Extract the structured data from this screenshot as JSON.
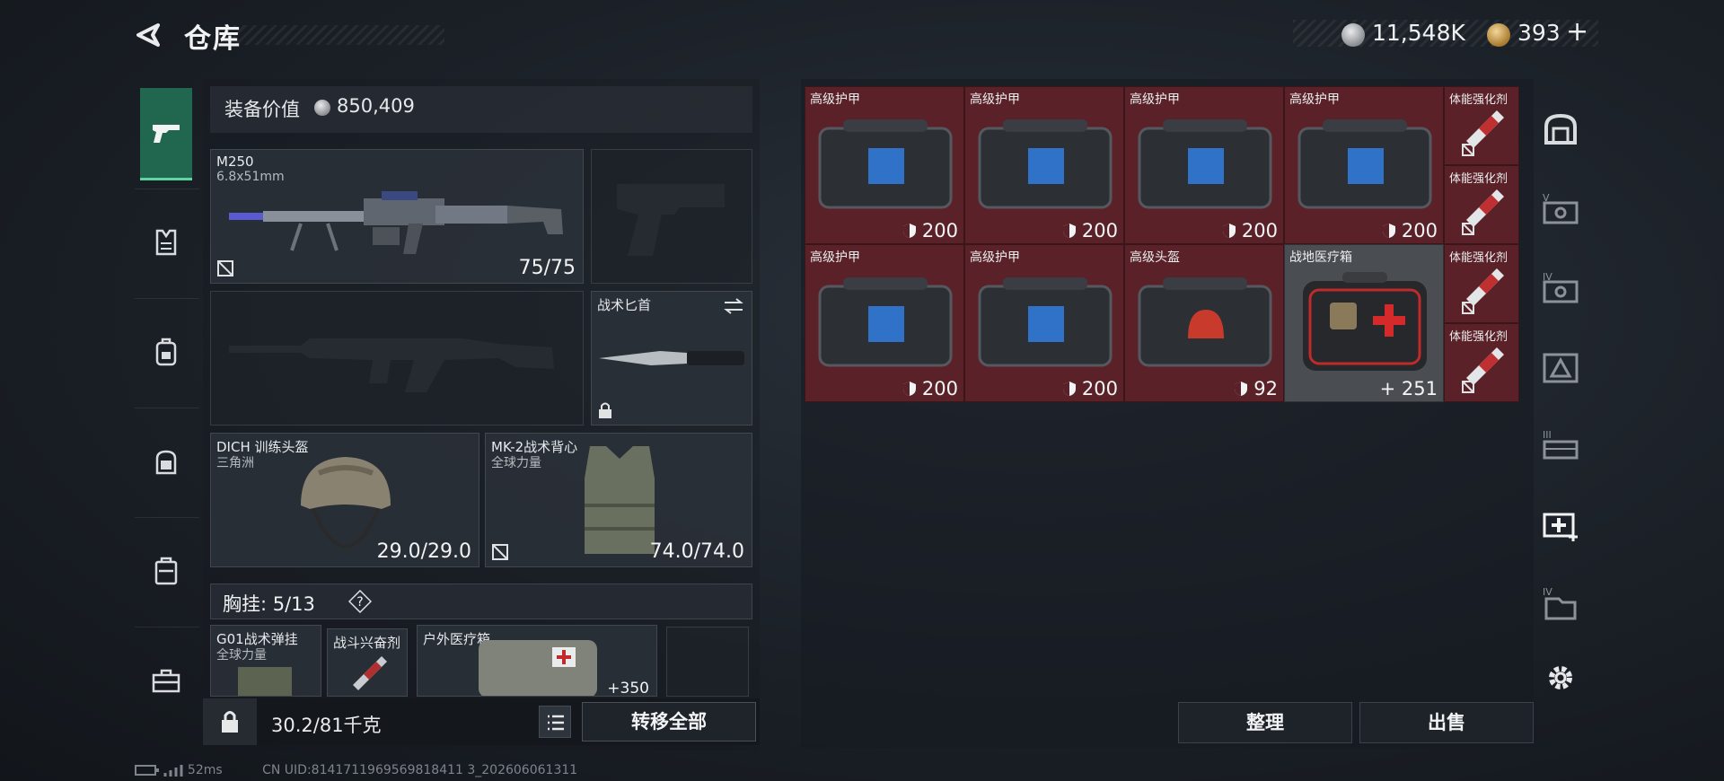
{
  "header": {
    "title": "仓库",
    "currency_silver": "11,548K",
    "currency_gold": "393",
    "gold_add": "+"
  },
  "equipment": {
    "value_label": "装备价值",
    "value_amount": "850,409",
    "primary": {
      "name": "M250",
      "caliber": "6.8x51mm",
      "ammo": "75/75"
    },
    "knife": {
      "name": "战术匕首"
    },
    "helmet": {
      "name": "DICH 训练头盔",
      "faction": "三角洲",
      "durability": "29.0/29.0"
    },
    "vest": {
      "name": "MK-2战术背心",
      "faction": "全球力量",
      "durability": "74.0/74.0"
    },
    "chest_rig": {
      "label": "胸挂: 5/13",
      "help": "?"
    },
    "rig_items": [
      {
        "name": "G01战术弹挂",
        "sub": "全球力量"
      },
      {
        "name": "战斗兴奋剂",
        "sub": ""
      },
      {
        "name": "户外医疗箱",
        "sub": "",
        "value": "+350"
      }
    ]
  },
  "bottom_left": {
    "weight": "30.2/81千克",
    "transfer_all": "转移全部"
  },
  "storage": {
    "items": [
      {
        "name": "高级护甲",
        "value": "200",
        "color": "red"
      },
      {
        "name": "高级护甲",
        "value": "200",
        "color": "red"
      },
      {
        "name": "高级护甲",
        "value": "200",
        "color": "red"
      },
      {
        "name": "高级护甲",
        "value": "200",
        "color": "red"
      },
      {
        "name": "高级护甲",
        "value": "200",
        "color": "red"
      },
      {
        "name": "高级护甲",
        "value": "200",
        "color": "red"
      },
      {
        "name": "高级头盔",
        "value": "92",
        "color": "red"
      },
      {
        "name": "战地医疗箱",
        "value": "+ 251",
        "color": "gray"
      }
    ],
    "small_items": [
      {
        "name": "体能强化剂"
      },
      {
        "name": "体能强化剂"
      },
      {
        "name": "体能强化剂"
      },
      {
        "name": "体能强化剂"
      }
    ],
    "sort_label": "整理",
    "sell_label": "出售"
  },
  "status": {
    "ping": "52ms",
    "uid": "CN UID:8141711969569818411 3_202606061311"
  },
  "colors": {
    "accent_green": "#21664f",
    "item_red": "#5a2228",
    "item_gray": "#4a4d52"
  }
}
